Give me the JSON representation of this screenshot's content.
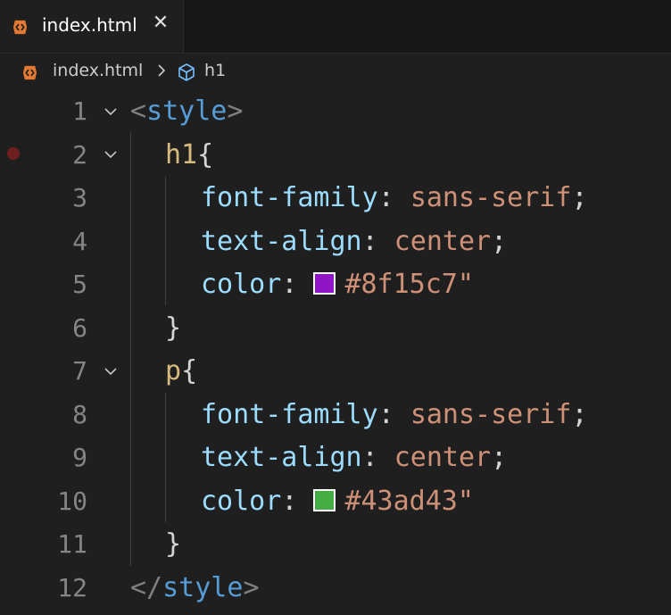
{
  "tab": {
    "title": "index.html"
  },
  "breadcrumb": {
    "file": "index.html",
    "symbol": "h1"
  },
  "editor": {
    "line_numbers": [
      "1",
      "2",
      "3",
      "4",
      "5",
      "6",
      "7",
      "8",
      "9",
      "10",
      "11",
      "12"
    ],
    "lines": {
      "l1": {
        "open": "<",
        "tag": "style",
        "close": ">"
      },
      "l2": {
        "selector": "h1",
        "brace": "{"
      },
      "l3": {
        "prop": "font-family",
        "colon": ": ",
        "value": "sans-serif",
        "semi": ";"
      },
      "l4": {
        "prop": "text-align",
        "colon": ": ",
        "value": "center",
        "semi": ";"
      },
      "l5": {
        "prop": "color",
        "colon": ": ",
        "value": "#8f15c7\""
      },
      "l6": {
        "brace": "}"
      },
      "l7": {
        "selector": "p",
        "brace": "{"
      },
      "l8": {
        "prop": "font-family",
        "colon": ": ",
        "value": "sans-serif",
        "semi": ";"
      },
      "l9": {
        "prop": "text-align",
        "colon": ": ",
        "value": "center",
        "semi": ";"
      },
      "l10": {
        "prop": "color",
        "colon": ": ",
        "value": "#43ad43\""
      },
      "l11": {
        "brace": "}"
      },
      "l12": {
        "open": "</",
        "tag": "style",
        "close": ">"
      }
    },
    "swatches": {
      "h1_color": "#8f15c7",
      "p_color": "#43ad43"
    }
  },
  "colors": {
    "background": "#1f1f1f",
    "tag": "#569cd6",
    "selector": "#d7ba7d",
    "property": "#9cdcfe",
    "value": "#ce9178",
    "breakpoint": "#6f1f1f",
    "html_icon": "#e37933"
  },
  "icons": [
    "html-file-icon",
    "close-icon",
    "chevron-right-icon",
    "symbol-cube-icon",
    "chevron-down-icon",
    "breakpoint-icon"
  ]
}
